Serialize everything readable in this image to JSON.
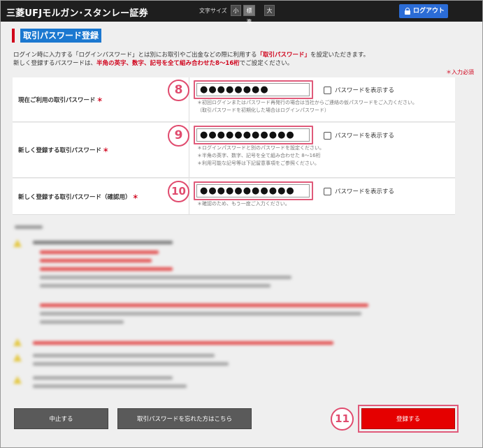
{
  "header": {
    "brand": "三菱UFJモルガン･スタンレー証券",
    "font_size_label": "文字サイズ",
    "font_sizes": [
      "小",
      "標準",
      "大"
    ],
    "logout_label": "ログアウト"
  },
  "page": {
    "title": "取引パスワード登録",
    "intro_line1_a": "ログイン時に入力する「ログインパスワード」とは別にお取引やご出金などの際に利用する",
    "intro_line1_b": "「取引パスワード」",
    "intro_line1_c": "を設定いただきます。",
    "intro_line2_a": "新しく登録するパスワードは、",
    "intro_line2_b": "半角の英字、数字、記号を全て組み合わせた8～16桁",
    "intro_line2_c": "でご設定ください。",
    "required_note": "＊入力必須"
  },
  "form": {
    "show_password_label": "パスワードを表示する",
    "rows": [
      {
        "label": "現在ご利用の取引パスワード",
        "required_mark": "＊",
        "value": "●●●●●●●●",
        "step": "8",
        "help": [
          "＊初回ログインまたはパスワード再発行の場合は当社からご連絡の仮パスワードをご入力ください。",
          "（取引パスワードを初期化した場合はログインパスワード）"
        ]
      },
      {
        "label": "新しく登録する取引パスワード",
        "required_mark": "＊",
        "value": "●●●●●●●●●●●",
        "step": "9",
        "help": [
          "＊ログインパスワードと別のパスワードを設定ください。",
          "＊半角の英字、数字、記号を全て組み合わせた 8～16桁",
          "＊利用可能な記号等は下記留意事項をご参照ください。"
        ]
      },
      {
        "label": "新しく登録する取引パスワード（確認用）",
        "required_mark": "＊",
        "value": "●●●●●●●●●●●",
        "step": "10",
        "help": [
          "＊確認のため、もう一度ご入力ください。"
        ]
      }
    ]
  },
  "actions": {
    "cancel": "中止する",
    "forgot": "取引パスワードを忘れた方はこちら",
    "register": "登録する",
    "register_step": "11"
  },
  "colors": {
    "accent_red": "#d0021b",
    "title_blue": "#1b78d0",
    "highlight_pink": "#e04b6e",
    "register_red": "#e50000"
  }
}
